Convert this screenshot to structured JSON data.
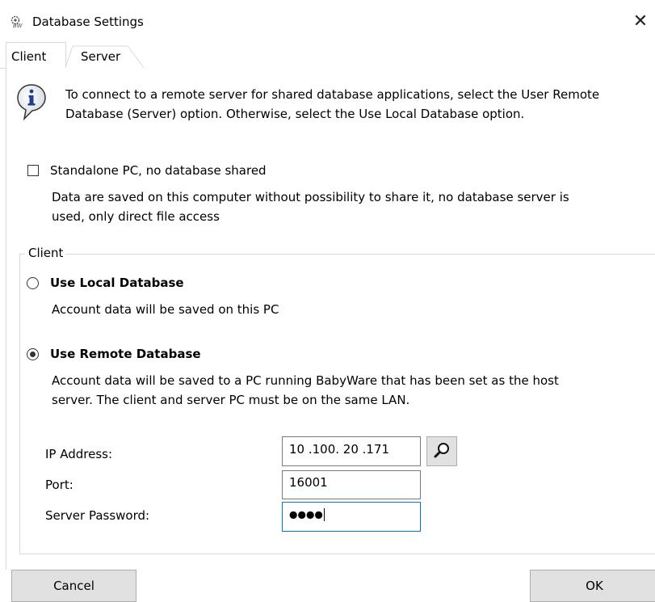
{
  "window": {
    "title": "Database Settings",
    "close_glyph": "✕"
  },
  "tabs": [
    {
      "label": "Client"
    },
    {
      "label": "Server"
    }
  ],
  "info": {
    "line1": "To connect to a remote server for shared database applications, select the User Remote",
    "line2": "Database (Server) option. Otherwise, select the Use Local Database option."
  },
  "standalone": {
    "label": "Standalone PC, no database shared",
    "desc1": "Data are saved on this computer without possibility to share it, no database server is",
    "desc2": "used, only direct file access",
    "checked": false
  },
  "client_group": {
    "label": "Client",
    "local": {
      "label": "Use Local Database",
      "desc": "Account data will be saved on this PC",
      "selected": false
    },
    "remote": {
      "label": "Use Remote Database",
      "desc1": "Account data will be saved to a PC running BabyWare that has been set as the host",
      "desc2": "server. The client and server PC must be on the same LAN.",
      "selected": true
    },
    "ip_label": "IP Address:",
    "ip_value": "10 .100. 20 .171",
    "port_label": "Port:",
    "port_value": "16001",
    "password_label": "Server Password:",
    "password_value": "●●●●"
  },
  "buttons": {
    "cancel": "Cancel",
    "ok": "OK"
  },
  "icons": {
    "app": "babyware-app-icon",
    "info": "info-icon",
    "search": "magnifier-icon"
  }
}
